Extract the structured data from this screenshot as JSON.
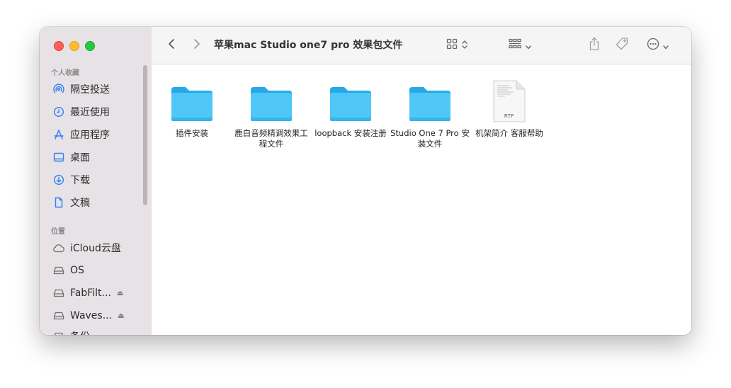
{
  "window": {
    "title": "苹果mac Studio one7 pro 效果包文件"
  },
  "sidebar": {
    "favorites_title": "个人收藏",
    "favorites": [
      {
        "label": "隔空投送",
        "icon": "airdrop-icon"
      },
      {
        "label": "最近使用",
        "icon": "clock-icon"
      },
      {
        "label": "应用程序",
        "icon": "applications-icon"
      },
      {
        "label": "桌面",
        "icon": "desktop-icon"
      },
      {
        "label": "下载",
        "icon": "download-icon"
      },
      {
        "label": "文稿",
        "icon": "document-icon"
      }
    ],
    "locations_title": "位置",
    "locations": [
      {
        "label": "iCloud云盘",
        "icon": "cloud-icon"
      },
      {
        "label": "OS",
        "icon": "disk-icon"
      },
      {
        "label": "FabFilt...",
        "icon": "disk-icon",
        "eject": "⏏"
      },
      {
        "label": "Waves...",
        "icon": "disk-icon",
        "eject": "⏏"
      },
      {
        "label": "备份",
        "icon": "disk-icon"
      }
    ]
  },
  "files": [
    {
      "label": "插件安装",
      "type": "folder"
    },
    {
      "label": "鹿白音频精调效果工程文件",
      "type": "folder"
    },
    {
      "label": "loopback 安装注册",
      "type": "folder"
    },
    {
      "label": "Studio One 7 Pro 安装文件",
      "type": "folder"
    },
    {
      "label": "机架简介 客服帮助",
      "type": "rtf",
      "badge": "RTF"
    }
  ],
  "colors": {
    "accent": "#2f7ef6",
    "folder": "#4fc3f7",
    "folder_dark": "#27a9e8",
    "sidebar_bg": "#e7e2e5"
  }
}
